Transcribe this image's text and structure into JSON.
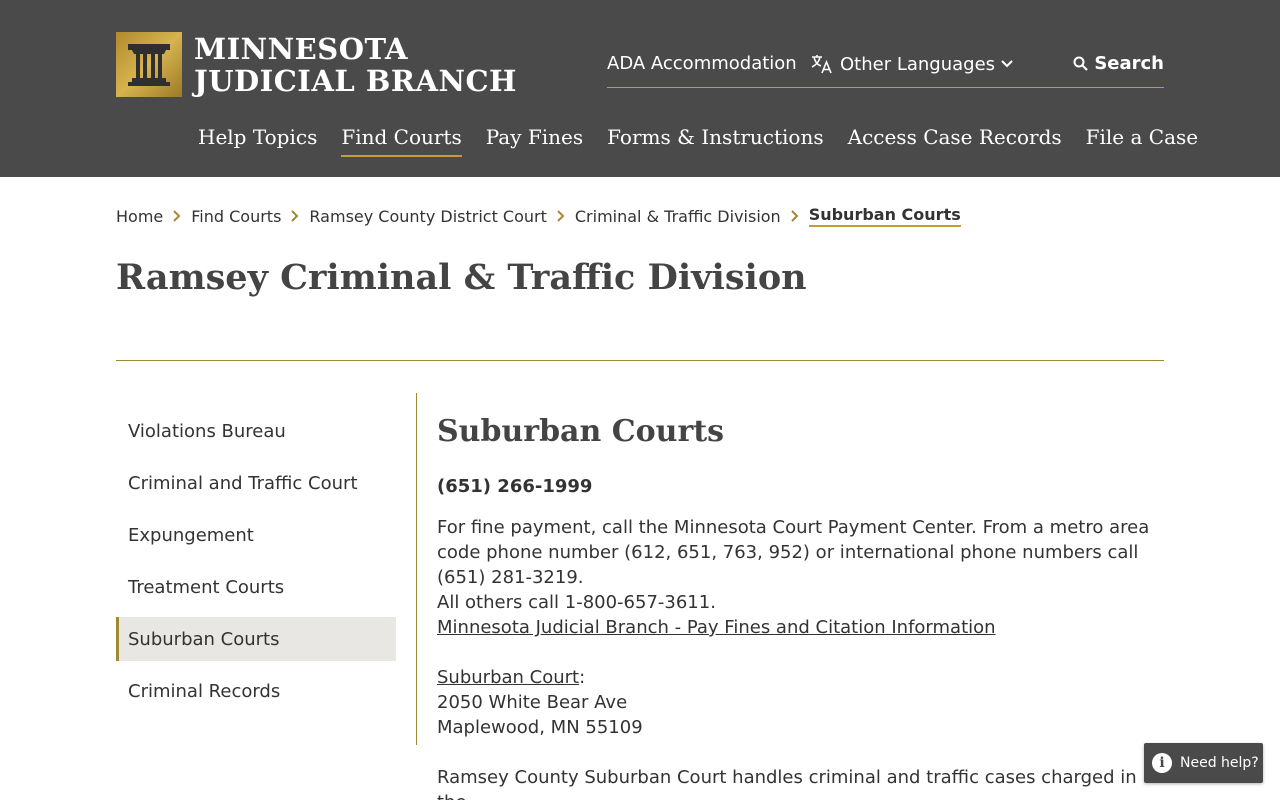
{
  "header": {
    "logo_line1": "MINNESOTA",
    "logo_line2": "JUDICIAL BRANCH",
    "utility": {
      "ada": "ADA Accommodation",
      "languages": "Other Languages",
      "search": "Search"
    },
    "nav": [
      "Help Topics",
      "Find Courts",
      "Pay Fines",
      "Forms & Instructions",
      "Access Case Records",
      "File a Case"
    ],
    "active_nav": "Find Courts"
  },
  "breadcrumb": {
    "items": [
      "Home",
      "Find Courts",
      "Ramsey County District Court",
      "Criminal & Traffic Division"
    ],
    "current": "Suburban Courts"
  },
  "page_title": "Ramsey Criminal & Traffic Division",
  "sidenav": {
    "items": [
      "Violations Bureau",
      "Criminal and Traffic Court",
      "Expungement",
      "Treatment Courts",
      "Suburban Courts",
      "Criminal Records"
    ],
    "active": "Suburban Courts"
  },
  "content": {
    "heading": "Suburban Courts",
    "phone": "(651) 266-1999",
    "fine_payment": "For fine payment, call the Minnesota Court Payment Center.  From a metro area code phone number (612, 651, 763, 952) or international phone numbers call (651) 281-3219.",
    "others": "All others call 1-800-657-3611.",
    "pay_link": "Minnesota Judicial Branch - Pay Fines and Citation Information",
    "court_link": "Suburban Court",
    "court_colon": ":",
    "address1": "2050 White Bear Ave",
    "address2": "Maplewood, MN 55109",
    "description": "Ramsey County Suburban Court handles criminal and traffic cases charged in the"
  },
  "help": {
    "label": "Need help?",
    "icon_glyph": "i"
  },
  "colors": {
    "header_bg": "#4a4a4a",
    "accent_gold": "#c69a3a",
    "rule_gold": "#a38833",
    "active_bg": "#e9e7e4"
  }
}
